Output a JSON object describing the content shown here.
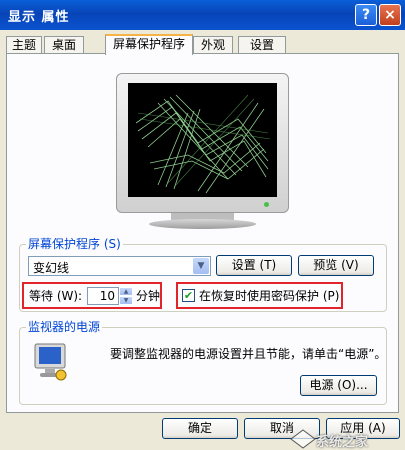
{
  "window": {
    "title": "显示 属性",
    "help_glyph": "?",
    "close_glyph": "×"
  },
  "tabs": [
    {
      "label": "主题",
      "active": false
    },
    {
      "label": "桌面",
      "active": false
    },
    {
      "label": "屏幕保护程序",
      "active": true
    },
    {
      "label": "外观",
      "active": false
    },
    {
      "label": "设置",
      "active": false
    }
  ],
  "screensaver": {
    "group_title": "屏幕保护程序 (S)",
    "selected": "变幻线",
    "settings_button": "设置 (T)",
    "preview_button": "预览 (V)",
    "wait_label": "等待 (W):",
    "wait_value": "10",
    "wait_unit": "分钟",
    "password_label": "在恢复时使用密码保护 (P)",
    "password_checked": true
  },
  "power": {
    "group_title": "监视器的电源",
    "description": "要调整监视器的电源设置并且节能，请单击“电源”。",
    "button": "电源 (O)..."
  },
  "footer": {
    "ok": "确定",
    "cancel": "取消",
    "apply": "应用 (A)"
  },
  "watermark": {
    "text": "系统之家"
  },
  "colors": {
    "titlebar": "#0a53d0",
    "dialog_bg": "#ece9d8",
    "group_title": "#0046d5",
    "highlight_border": "#e0242a",
    "screensaver_lines": "#9fe39f"
  }
}
